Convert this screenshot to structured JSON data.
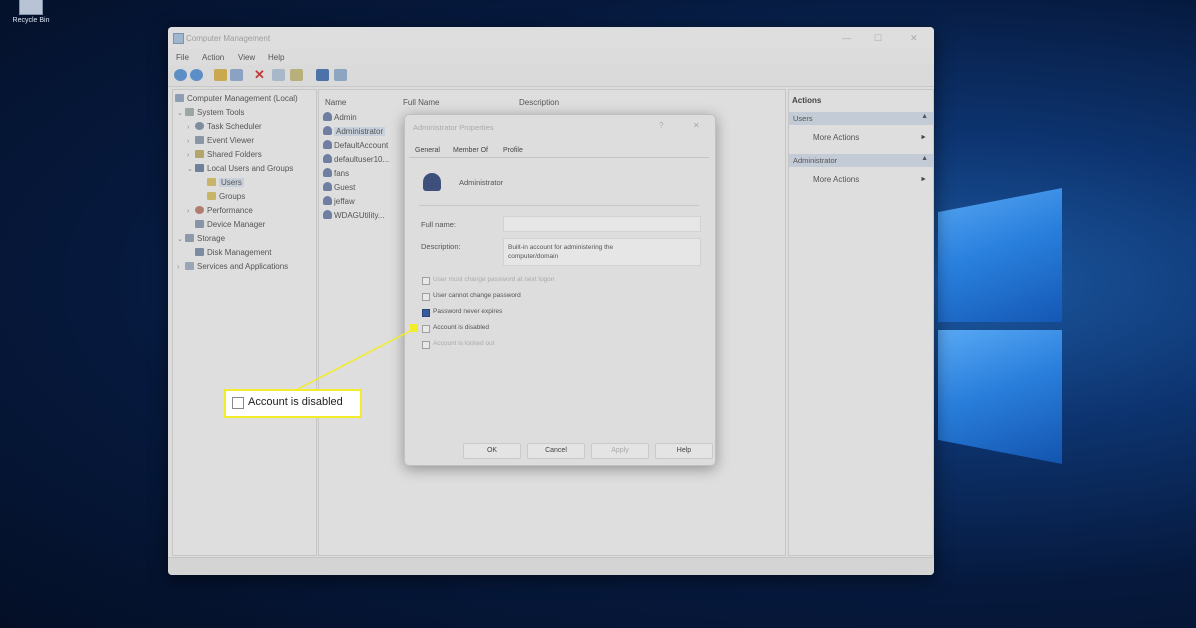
{
  "desktop": {
    "recycle_bin_label": "Recycle Bin"
  },
  "window": {
    "title": "Computer Management",
    "menu": [
      "File",
      "Action",
      "View",
      "Help"
    ]
  },
  "tree": {
    "root": "Computer Management (Local)",
    "system_tools": "System Tools",
    "task_scheduler": "Task Scheduler",
    "event_viewer": "Event Viewer",
    "shared_folders": "Shared Folders",
    "local_users_groups": "Local Users and Groups",
    "users": "Users",
    "groups": "Groups",
    "performance": "Performance",
    "device_manager": "Device Manager",
    "storage": "Storage",
    "disk_management": "Disk Management",
    "services_apps": "Services and Applications"
  },
  "list": {
    "columns": {
      "name": "Name",
      "full_name": "Full Name",
      "description": "Description"
    },
    "users": [
      "Admin",
      "Administrator",
      "DefaultAccount",
      "defaultuser10...",
      "fans",
      "Guest",
      "jeffaw",
      "WDAGUtility..."
    ]
  },
  "actions": {
    "header": "Actions",
    "section1": "Users",
    "section1_item": "More Actions",
    "section2": "Administrator",
    "section2_item": "More Actions"
  },
  "dialog": {
    "title": "Administrator Properties",
    "tabs": [
      "General",
      "Member Of",
      "Profile"
    ],
    "account_name": "Administrator",
    "full_name_label": "Full name:",
    "full_name_value": "",
    "description_label": "Description:",
    "description_value": "Built-in account for administering the computer/domain",
    "options": {
      "must_change": "User must change password at next logon",
      "cannot_change": "User cannot change password",
      "never_expires": "Password never expires",
      "disabled": "Account is disabled",
      "locked_out": "Account is locked out"
    },
    "buttons": {
      "ok": "OK",
      "cancel": "Cancel",
      "apply": "Apply",
      "help": "Help"
    }
  },
  "callout": {
    "label": "Account is disabled"
  },
  "colors": {
    "highlight": "#f2ec2a",
    "selection": "#c8d0dc"
  }
}
